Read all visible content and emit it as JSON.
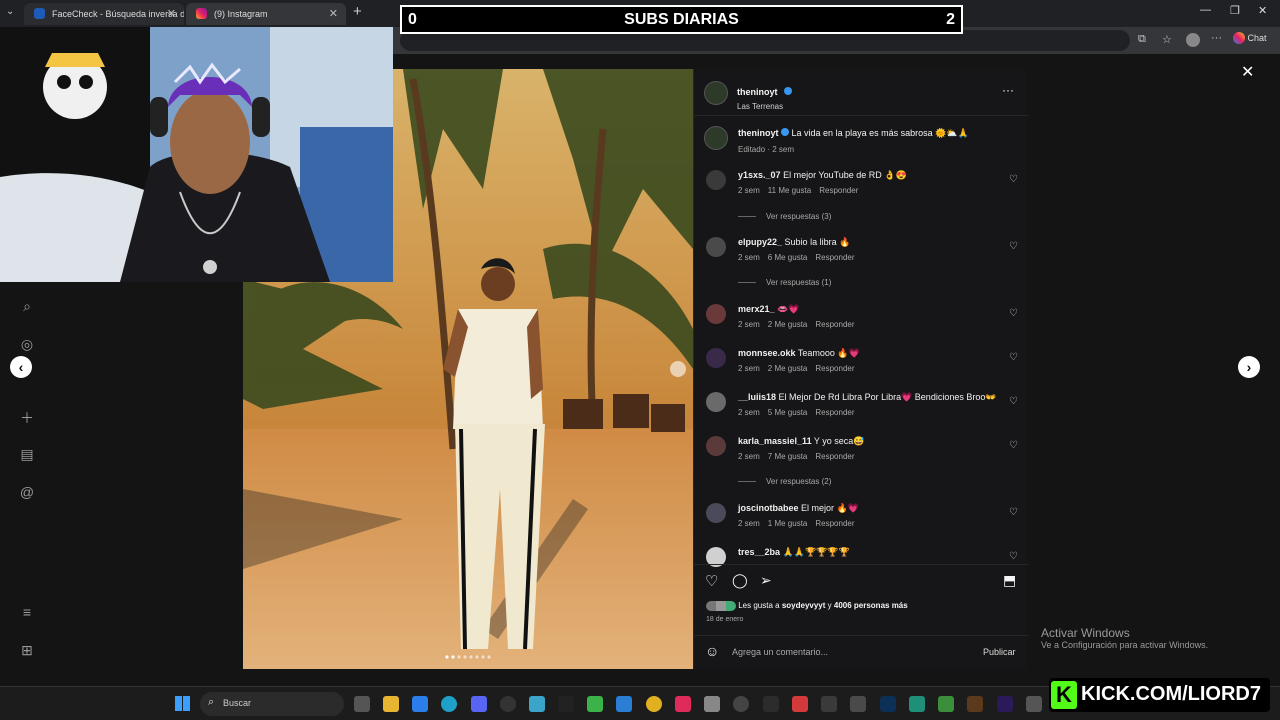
{
  "browser": {
    "tabs": [
      {
        "label": "FaceCheck - Búsqueda inversa de"
      },
      {
        "label": "(9) Instagram"
      }
    ],
    "chat_label": "Chat"
  },
  "overlay": {
    "subs_left": "0",
    "subs_title": "SUBS DIARIAS",
    "subs_right": "2",
    "kick_text": "KICK.COM/LIORD7",
    "watermark_title": "Activar Windows",
    "watermark_sub": "Ve a Configuración para activar Windows."
  },
  "post": {
    "username": "theninoyt",
    "location": "Las Terrenas",
    "caption": "La vida en la playa es más sabrosa 🌞⛅🙏",
    "caption_meta": "Editado · 2 sem",
    "likes_text_pre": "Les gusta a ",
    "likes_user": "soydeyvyyt",
    "likes_mid": " y ",
    "likes_count": "4006 personas más",
    "date": "18 de enero",
    "comment_placeholder": "Agrega un comentario...",
    "publish_label": "Publicar"
  },
  "comments": [
    {
      "user": "y1sxs._07",
      "text": "El mejor YouTube de RD 👌😍",
      "time": "2 sem",
      "likes": "11 Me gusta",
      "reply": "Responder",
      "replies": "Ver respuestas (3)"
    },
    {
      "user": "elpupy22_",
      "text": "Subio la libra 🔥",
      "time": "2 sem",
      "likes": "6 Me gusta",
      "reply": "Responder",
      "replies": "Ver respuestas (1)"
    },
    {
      "user": "merx21_",
      "text": "👄💗",
      "time": "2 sem",
      "likes": "2 Me gusta",
      "reply": "Responder",
      "replies": ""
    },
    {
      "user": "monnsee.okk",
      "text": "Teamooo 🔥💗",
      "time": "2 sem",
      "likes": "2 Me gusta",
      "reply": "Responder",
      "replies": ""
    },
    {
      "user": "__luiis18",
      "text": "El Mejor De Rd Libra Por Libra💗 Bendiciones Broo👐",
      "time": "2 sem",
      "likes": "5 Me gusta",
      "reply": "Responder",
      "replies": ""
    },
    {
      "user": "karla_massiel_11",
      "text": "Y yo seca😅",
      "time": "2 sem",
      "likes": "7 Me gusta",
      "reply": "Responder",
      "replies": "Ver respuestas (2)"
    },
    {
      "user": "joscinotbabee",
      "text": "El mejor 🔥💗",
      "time": "2 sem",
      "likes": "1 Me gusta",
      "reply": "Responder",
      "replies": ""
    },
    {
      "user": "tres__2ba",
      "text": "🙏🙏🏆🏆🏆🏆",
      "time": "",
      "likes": "",
      "reply": "",
      "replies": ""
    }
  ],
  "taskbar": {
    "search_placeholder": "Buscar"
  },
  "colors": {
    "verified": "#3897f0",
    "kick_green": "#53fc18"
  }
}
